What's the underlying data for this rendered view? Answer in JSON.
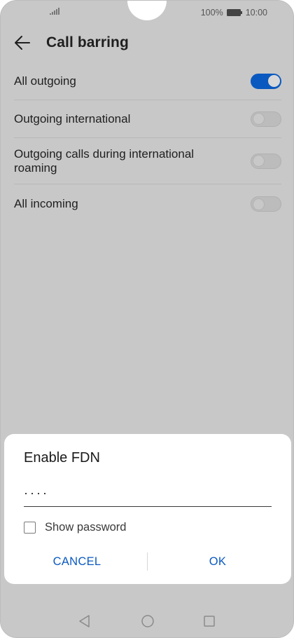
{
  "status_bar": {
    "battery_percent": "100%",
    "time": "10:00",
    "icons": [
      "signal-icon",
      "battery-icon"
    ]
  },
  "header": {
    "title": "Call barring",
    "back_icon": "arrow-left-icon"
  },
  "settings": [
    {
      "label": "All outgoing",
      "enabled": true
    },
    {
      "label": "Outgoing international",
      "enabled": false
    },
    {
      "label": "Outgoing calls during international roaming",
      "enabled": false
    },
    {
      "label": "All incoming",
      "enabled": false
    }
  ],
  "dialog": {
    "title": "Enable FDN",
    "password_value": "····",
    "show_password_label": "Show password",
    "show_password_checked": false,
    "cancel_label": "CANCEL",
    "ok_label": "OK"
  },
  "nav_bar": {
    "icons": [
      "back-triangle-icon",
      "home-circle-icon",
      "recents-square-icon"
    ]
  },
  "colors": {
    "accent": "#0a59c0",
    "screen_dim": "#c8c8c8",
    "dialog_bg": "#ffffff"
  }
}
